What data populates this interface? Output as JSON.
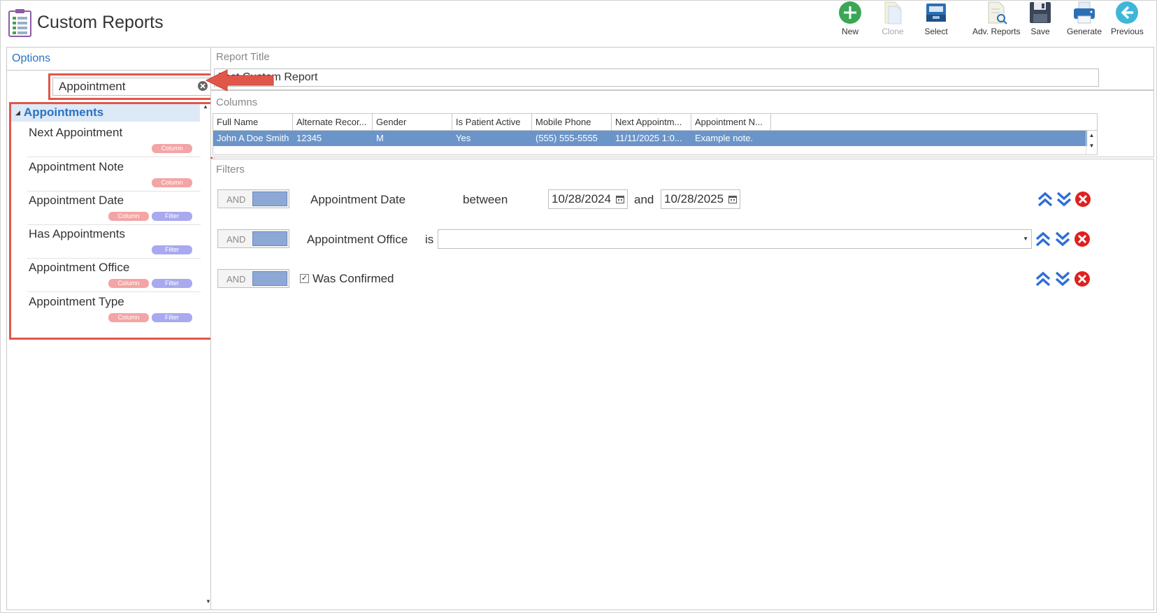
{
  "app": {
    "title": "Custom Reports"
  },
  "toolbar": {
    "new": "New",
    "clone": "Clone",
    "select": "Select",
    "adv_reports": "Adv. Reports",
    "save": "Save",
    "generate": "Generate",
    "previous": "Previous"
  },
  "options": {
    "header": "Options",
    "search_value": "Appointment",
    "group": "Appointments",
    "items": [
      {
        "label": "Next Appointment",
        "column": "Column",
        "filter": ""
      },
      {
        "label": "Appointment Note",
        "column": "Column",
        "filter": ""
      },
      {
        "label": "Appointment Date",
        "column": "Column",
        "filter": "Filter"
      },
      {
        "label": "Has Appointments",
        "column": "",
        "filter": "Filter"
      },
      {
        "label": "Appointment Office",
        "column": "Column",
        "filter": "Filter"
      },
      {
        "label": "Appointment Type",
        "column": "Column",
        "filter": "Filter"
      }
    ]
  },
  "report_title": {
    "label": "Report Title",
    "value": "Test Custom Report"
  },
  "columns": {
    "label": "Columns",
    "headers": [
      "Full Name",
      "Alternate Recor...",
      "Gender",
      "Is Patient Active",
      "Mobile Phone",
      "Next Appointm...",
      "Appointment N..."
    ],
    "row": [
      "John A Doe Smith",
      "12345",
      "M",
      "Yes",
      "(555) 555-5555",
      "11/11/2025 1:0...",
      "Example note."
    ]
  },
  "filters": {
    "label": "Filters",
    "toggle_label": "AND",
    "rows": [
      {
        "field": "Appointment Date",
        "operator": "between",
        "from": "10/28/2024",
        "joiner": "and",
        "to": "10/28/2025"
      },
      {
        "field": "Appointment Office",
        "operator": "is",
        "value": ""
      },
      {
        "field": "Was Confirmed",
        "checked": true,
        "check_mark": "✓"
      }
    ]
  },
  "colors": {
    "accent_blue": "#2a73c2",
    "selected_row": "#6b95c9",
    "highlight_red": "#e0574a",
    "column_chip": "#f4a4a4",
    "filter_chip": "#a9a9ef"
  }
}
